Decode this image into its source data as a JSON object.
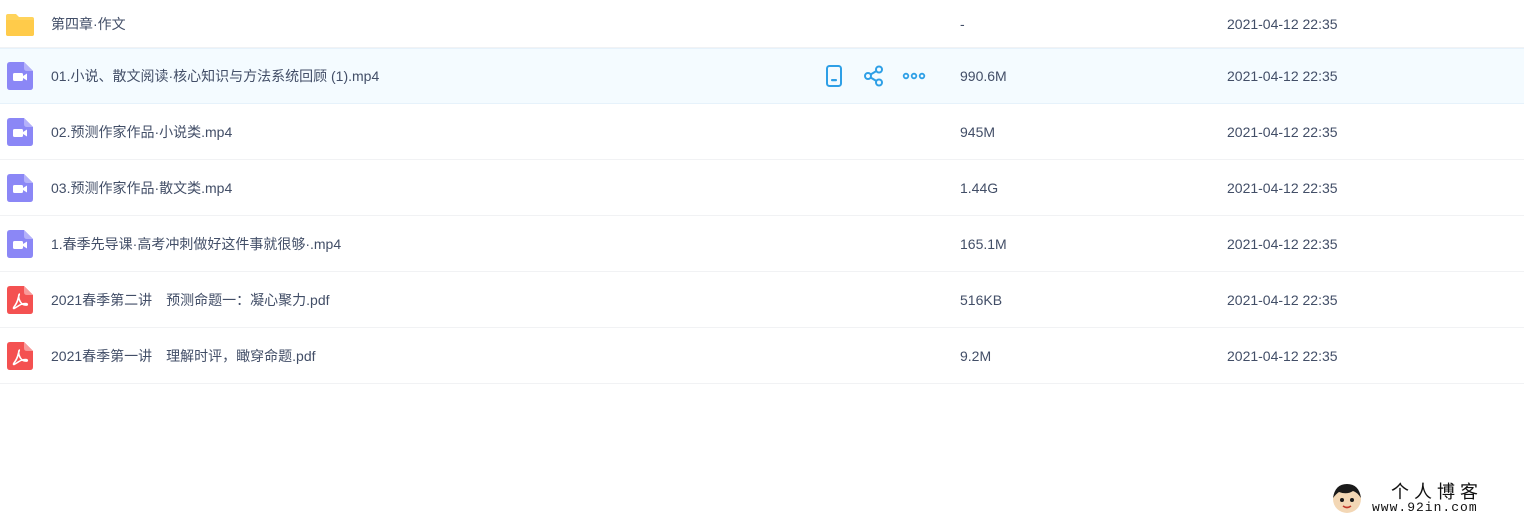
{
  "files": [
    {
      "name": "第四章·作文",
      "type": "folder",
      "icon": "folder-icon",
      "size": "-",
      "date": "2021-04-12 22:35"
    },
    {
      "name": "01.小说、散文阅读·核心知识与方法系统回顾 (1).mp4",
      "type": "video",
      "icon": "video-file-icon",
      "size": "990.6M",
      "date": "2021-04-12 22:35"
    },
    {
      "name": "02.预测作家作品·小说类.mp4",
      "type": "video",
      "icon": "video-file-icon",
      "size": "945M",
      "date": "2021-04-12 22:35"
    },
    {
      "name": "03.预测作家作品·散文类.mp4",
      "type": "video",
      "icon": "video-file-icon",
      "size": "1.44G",
      "date": "2021-04-12 22:35"
    },
    {
      "name": "1.春季先导课·高考冲刺做好这件事就很够·.mp4",
      "type": "video",
      "icon": "video-file-icon",
      "size": "165.1M",
      "date": "2021-04-12 22:35"
    },
    {
      "name": "2021春季第二讲　预测命题一：凝心聚力.pdf",
      "type": "pdf",
      "icon": "pdf-file-icon",
      "size": "516KB",
      "date": "2021-04-12 22:35"
    },
    {
      "name": "2021春季第一讲　理解时评，瞰穿命题.pdf",
      "type": "pdf",
      "icon": "pdf-file-icon",
      "size": "9.2M",
      "date": "2021-04-12 22:35"
    }
  ],
  "hover_actions": [
    "phone-icon",
    "share-icon",
    "more-icon"
  ],
  "colors": {
    "folder": "#ffd35b",
    "video": "#8b87f6",
    "pdf": "#f45151",
    "action": "#2e9fe6",
    "hover_row": "#f4fbff",
    "text": "#424e67"
  },
  "watermark": {
    "title": "个人博客",
    "url": "www.92in.com"
  }
}
